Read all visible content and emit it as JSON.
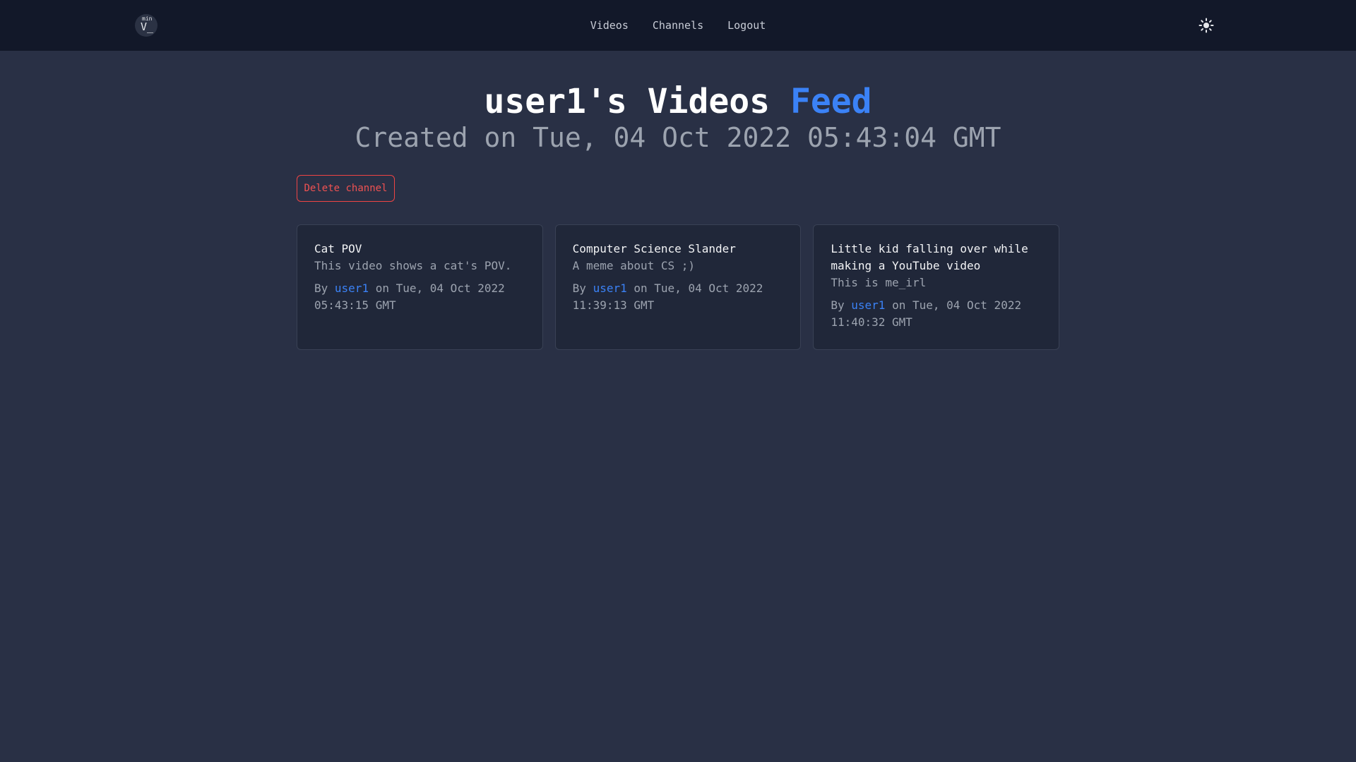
{
  "navbar": {
    "logo_superscript": "min",
    "logo_text": "V_",
    "links": [
      "Videos",
      "Channels",
      "Logout"
    ],
    "theme_icon": "sun-icon"
  },
  "header": {
    "title_main": "user1's Videos",
    "title_accent": "Feed",
    "subtitle": "Created on Tue, 04 Oct 2022 05:43:04 GMT"
  },
  "actions": {
    "delete_label": "Delete channel"
  },
  "videos": [
    {
      "title": "Cat POV",
      "description": "This video shows a cat's POV.",
      "by_prefix": "By",
      "author": "user1",
      "date": "on Tue, 04 Oct 2022 05:43:15 GMT"
    },
    {
      "title": "Computer Science Slander",
      "description": "A meme about CS ;)",
      "by_prefix": "By",
      "author": "user1",
      "date": "on Tue, 04 Oct 2022 11:39:13 GMT"
    },
    {
      "title": "Little kid falling over while making a YouTube video",
      "description": "This is me_irl",
      "by_prefix": "By",
      "author": "user1",
      "date": "on Tue, 04 Oct 2022 11:40:32 GMT"
    }
  ],
  "colors": {
    "background": "#293045",
    "navbar": "#121829",
    "accent": "#3b82f6",
    "danger": "#ef4444",
    "card": "#202739"
  }
}
